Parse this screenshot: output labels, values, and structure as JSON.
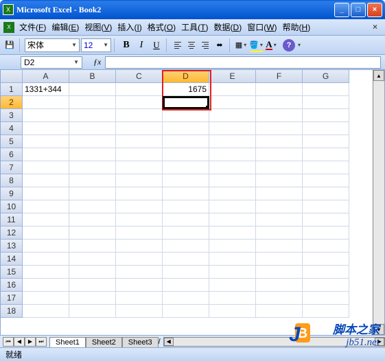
{
  "window": {
    "title": "Microsoft Excel - Book2"
  },
  "menu": {
    "items": [
      {
        "label": "文件",
        "key": "F"
      },
      {
        "label": "编辑",
        "key": "E"
      },
      {
        "label": "视图",
        "key": "V"
      },
      {
        "label": "插入",
        "key": "I"
      },
      {
        "label": "格式",
        "key": "O"
      },
      {
        "label": "工具",
        "key": "T"
      },
      {
        "label": "数据",
        "key": "D"
      },
      {
        "label": "窗口",
        "key": "W"
      },
      {
        "label": "帮助",
        "key": "H"
      }
    ]
  },
  "toolbar": {
    "font_name": "宋体",
    "font_size": "12",
    "bold": "B",
    "italic": "I",
    "underline": "U"
  },
  "namebox": {
    "value": "D2"
  },
  "formulabar": {
    "value": ""
  },
  "columns": [
    "A",
    "B",
    "C",
    "D",
    "E",
    "F",
    "G"
  ],
  "rows": [
    "1",
    "2",
    "3",
    "4",
    "5",
    "6",
    "7",
    "8",
    "9",
    "10",
    "11",
    "12",
    "13",
    "14",
    "15",
    "16",
    "17",
    "18"
  ],
  "active_col": "D",
  "active_row": "2",
  "cells": {
    "A1": "1331+344",
    "D1": "1675"
  },
  "sheets": {
    "tabs": [
      "Sheet1",
      "Sheet2",
      "Sheet3"
    ],
    "active": 0
  },
  "status": {
    "text": "就绪"
  },
  "watermark": {
    "line1": "脚本之家",
    "line2": "jb51.net"
  }
}
